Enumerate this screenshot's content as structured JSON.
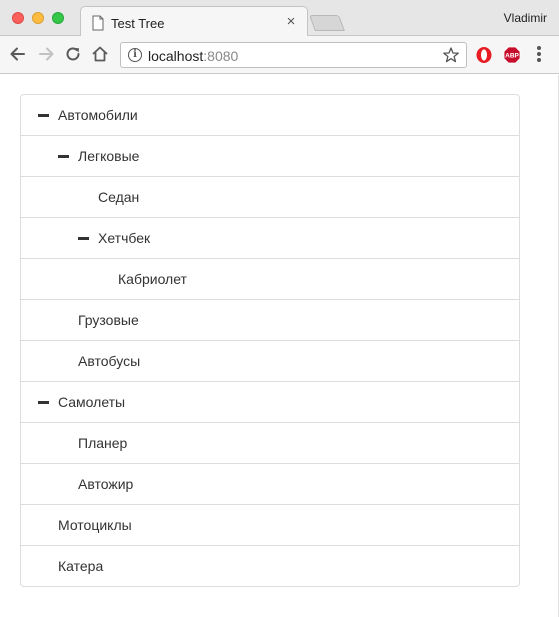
{
  "window": {
    "tab_title": "Test Tree",
    "tab_close": "×",
    "profile_name": "Vladimir"
  },
  "toolbar": {
    "url_host": "localhost",
    "url_port": ":8080",
    "info_glyph": "i",
    "extensions": [
      "opera-icon",
      "adblock-plus-icon"
    ],
    "abp_label": "ABP"
  },
  "colors": {
    "chrome_bg": "#e6e6e6",
    "opera_red": "#e81c23",
    "abp_red": "#c70d2c",
    "tree_border": "#dddddd",
    "text": "#333333"
  },
  "tree": {
    "nodes": [
      {
        "label": "Автомобили",
        "level": 0,
        "expanded": true
      },
      {
        "label": "Легковые",
        "level": 1,
        "expanded": true
      },
      {
        "label": "Седан",
        "level": 2,
        "expanded": null
      },
      {
        "label": "Хетчбек",
        "level": 2,
        "expanded": true
      },
      {
        "label": "Кабриолет",
        "level": 3,
        "expanded": null
      },
      {
        "label": "Грузовые",
        "level": 1,
        "expanded": null
      },
      {
        "label": "Автобусы",
        "level": 1,
        "expanded": null
      },
      {
        "label": "Самолеты",
        "level": 0,
        "expanded": true
      },
      {
        "label": "Планер",
        "level": 1,
        "expanded": null
      },
      {
        "label": "Автожир",
        "level": 1,
        "expanded": null
      },
      {
        "label": "Мотоциклы",
        "level": 0,
        "expanded": null
      },
      {
        "label": "Катера",
        "level": 0,
        "expanded": null
      }
    ]
  }
}
